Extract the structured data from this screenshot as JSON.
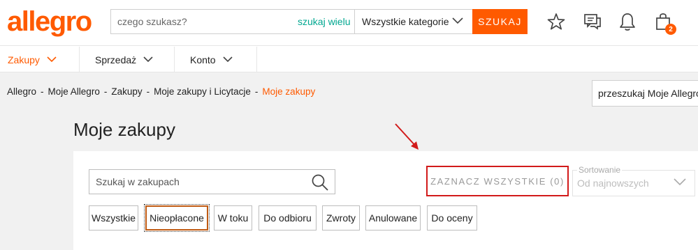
{
  "header": {
    "logo_text": "allegro",
    "search_placeholder": "czego szukasz?",
    "search_many_label": "szukaj wielu",
    "category_selected": "Wszystkie kategorie",
    "search_button_label": "SZUKAJ",
    "cart_badge_count": "2",
    "icons": [
      "star-icon",
      "chat-icon",
      "bell-icon",
      "shopping-bag-icon"
    ]
  },
  "nav": {
    "items": [
      {
        "label": "Zakupy",
        "active": true
      },
      {
        "label": "Sprzedaż",
        "active": false
      },
      {
        "label": "Konto",
        "active": false
      }
    ]
  },
  "breadcrumb": {
    "items": [
      "Allegro",
      "Moje Allegro",
      "Zakupy",
      "Moje zakupy i Licytacje"
    ],
    "current": "Moje zakupy",
    "separator": "-"
  },
  "my_allegro_search": {
    "placeholder": "przeszukaj Moje Allegro"
  },
  "page": {
    "title": "Moje zakupy"
  },
  "panel": {
    "search_placeholder": "Szukaj w zakupach",
    "select_all_label": "ZAZNACZ WSZYSTKIE (0)",
    "sort_label": "Sortowanie",
    "sort_value": "Od najnowszych",
    "filters": [
      {
        "label": "Wszystkie",
        "active": false
      },
      {
        "label": "Nieopłacone",
        "active": true
      },
      {
        "label": "W toku",
        "active": false
      },
      {
        "label": "Do odbioru",
        "active": false
      },
      {
        "label": "Zwroty",
        "active": false
      },
      {
        "label": "Anulowane",
        "active": false
      },
      {
        "label": "Do oceny",
        "active": false
      }
    ]
  },
  "colors": {
    "brand": "#ff5a00",
    "accent_link": "#00a790",
    "highlight_border": "#d21a1a",
    "annotation_arrow": "#d21a1a"
  }
}
